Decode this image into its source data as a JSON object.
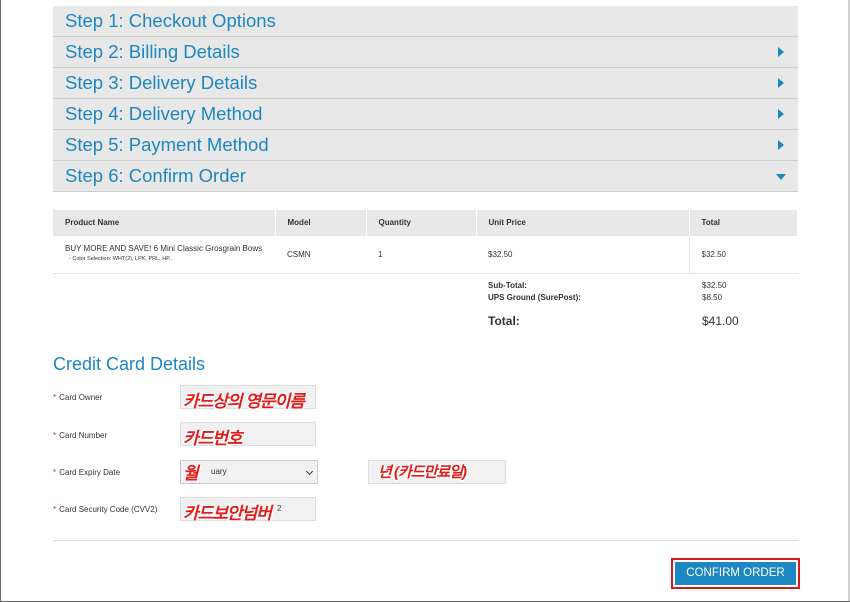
{
  "steps": [
    {
      "label": "Step 1: Checkout Options"
    },
    {
      "label": "Step 2: Billing Details"
    },
    {
      "label": "Step 3: Delivery Details"
    },
    {
      "label": "Step 4: Delivery Method"
    },
    {
      "label": "Step 5: Payment Method"
    },
    {
      "label": "Step 6: Confirm Order"
    }
  ],
  "table": {
    "headers": [
      "Product Name",
      "Model",
      "Quantity",
      "Unit Price",
      "Total"
    ],
    "row": {
      "product_name": "BUY MORE AND SAVE! 6 Mini Classic Grosgrain Bows",
      "option": "- Color Selection: WHT(2), LPK, PRL, HP..",
      "model": "CSMN",
      "quantity": "1",
      "unit_price": "$32.50",
      "total": "$32.50"
    }
  },
  "totals": {
    "subtotal_label": "Sub-Total:",
    "subtotal_value": "$32.50",
    "shipping_label": "UPS Ground (SurePost):",
    "shipping_value": "$8.50",
    "total_label": "Total:",
    "total_value": "$41.00"
  },
  "credit_card": {
    "title": "Credit Card Details",
    "required_mark": "*",
    "owner_label": "Card Owner",
    "owner_overlay": "카드상의 영문이름",
    "number_label": "Card Number",
    "number_overlay": "카드번호",
    "expiry_label": "Card Expiry Date",
    "month_overlay": "월",
    "month_value": "uary",
    "year_overlay": "년   (카드만료일)",
    "cvv_label": "Card Security Code (CVV2)",
    "cvv_overlay": "카드보안넘버",
    "cvv_value": "2"
  },
  "confirm_label": "CONFIRM ORDER",
  "colors": {
    "accent": "#1d87c1",
    "highlight": "#d71920",
    "overlay_text": "#e41b1b"
  }
}
